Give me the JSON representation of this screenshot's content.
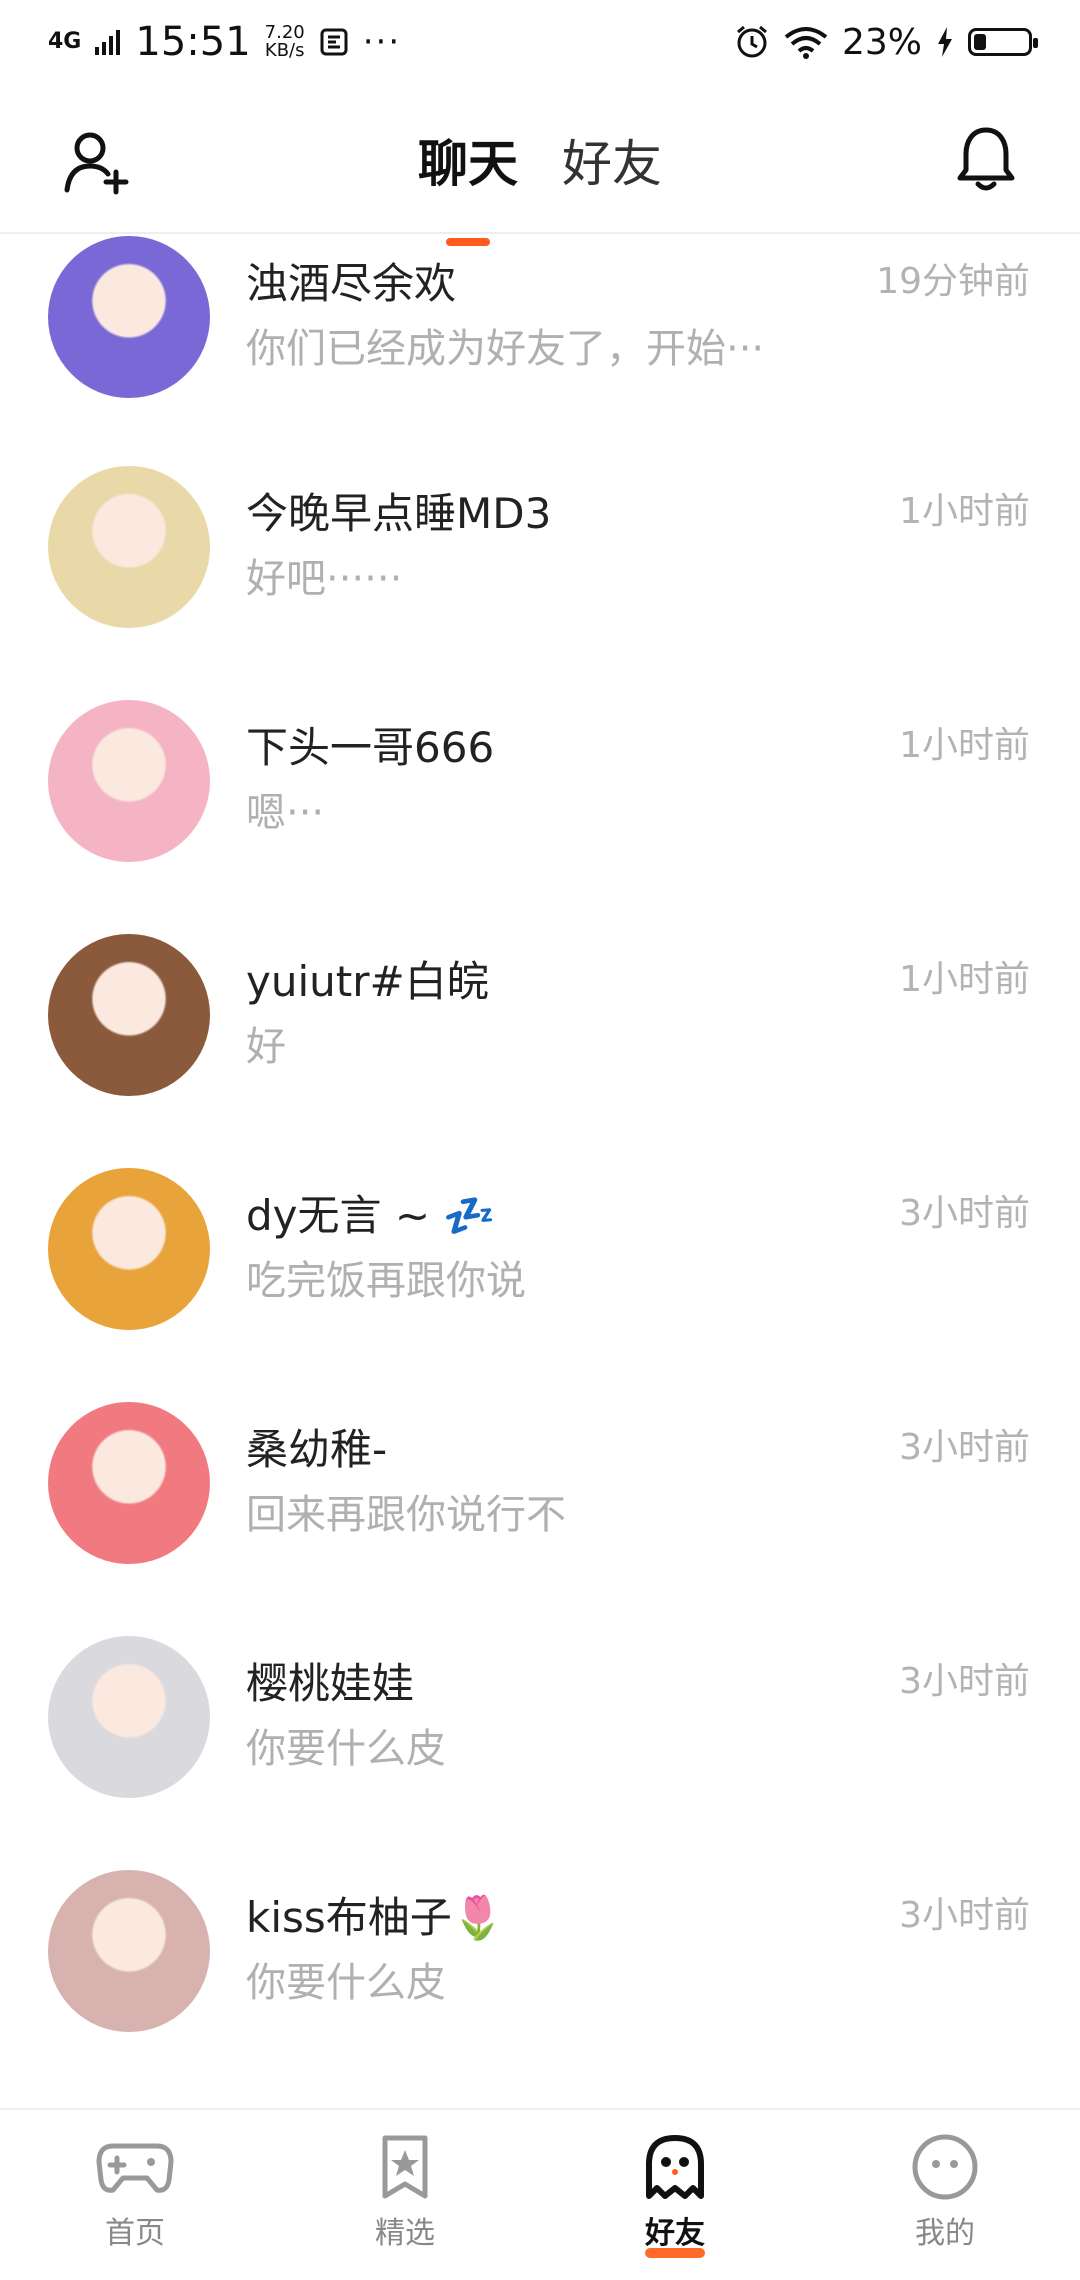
{
  "status_bar": {
    "network": "4G",
    "time": "15:51",
    "speed_value": "7.20",
    "speed_unit": "KB/s",
    "more": "···",
    "battery_percent": "23%",
    "battery_level": 0.23
  },
  "header": {
    "tabs": [
      {
        "label": "聊天",
        "active": true
      },
      {
        "label": "好友",
        "active": false
      }
    ]
  },
  "conversations": [
    {
      "name": "浊酒尽余欢",
      "time": "19分钟前",
      "preview": "你们已经成为好友了，开始···",
      "avatar_color": "#7a68d6"
    },
    {
      "name": "今晚早点睡MD3",
      "time": "1小时前",
      "preview": "好吧······",
      "avatar_color": "#e9d9a8"
    },
    {
      "name": "下头一哥666",
      "time": "1小时前",
      "preview": "嗯···",
      "avatar_color": "#f4b4c4"
    },
    {
      "name": "yuiutr#白皖",
      "time": "1小时前",
      "preview": "好",
      "avatar_color": "#8b5a3c"
    },
    {
      "name": "dy无言 ~ 💤",
      "time": "3小时前",
      "preview": "吃完饭再跟你说",
      "avatar_color": "#e8a33a"
    },
    {
      "name": "桑幼稚-",
      "time": "3小时前",
      "preview": "回来再跟你说行不",
      "avatar_color": "#f07a80"
    },
    {
      "name": "樱桃娃娃",
      "time": "3小时前",
      "preview": "你要什么皮",
      "avatar_color": "#d9d9de"
    },
    {
      "name": "kiss布柚子🌷",
      "time": "3小时前",
      "preview": "你要什么皮",
      "avatar_color": "#d8b2ae"
    }
  ],
  "bottom_nav": [
    {
      "label": "首页",
      "icon": "gamepad-icon",
      "active": false
    },
    {
      "label": "精选",
      "icon": "star-bookmark-icon",
      "active": false
    },
    {
      "label": "好友",
      "icon": "ghost-icon",
      "active": true
    },
    {
      "label": "我的",
      "icon": "face-icon",
      "active": false
    }
  ],
  "colors": {
    "accent": "#ff5a1f",
    "muted_text": "#b0b0b0"
  }
}
